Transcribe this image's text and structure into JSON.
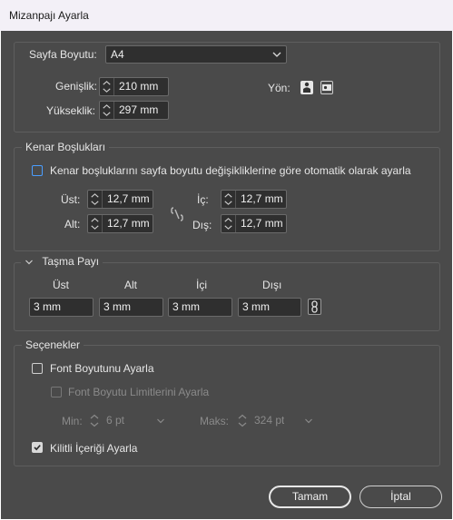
{
  "window": {
    "title": "Mizanpajı Ayarla"
  },
  "page_size": {
    "label": "Sayfa Boyutu:",
    "value": "A4",
    "width_label": "Genişlik:",
    "width_value": "210 mm",
    "height_label": "Yükseklik:",
    "height_value": "297 mm",
    "orientation_label": "Yön:"
  },
  "margins": {
    "title": "Kenar Boşlukları",
    "auto_adjust_label": "Kenar boşluklarını sayfa boyutu değişikliklerine göre otomatik olarak ayarla",
    "top_label": "Üst:",
    "top_value": "12,7 mm",
    "bottom_label": "Alt:",
    "bottom_value": "12,7 mm",
    "inside_label": "İç:",
    "inside_value": "12,7 mm",
    "outside_label": "Dış:",
    "outside_value": "12,7 mm"
  },
  "bleed": {
    "title": "Taşma Payı",
    "headers": [
      "Üst",
      "Alt",
      "İçi",
      "Dışı"
    ],
    "values": [
      "3 mm",
      "3 mm",
      "3 mm",
      "3 mm"
    ]
  },
  "options": {
    "title": "Seçenekler",
    "adjust_font_label": "Font Boyutunu Ayarla",
    "font_limits_label": "Font Boyutu Limitlerini Ayarla",
    "min_label": "Min:",
    "min_value": "6 pt",
    "max_label": "Maks:",
    "max_value": "324 pt",
    "adjust_locked_label": "Kilitli İçeriği Ayarla",
    "adjust_font_checked": false,
    "font_limits_checked": false,
    "adjust_locked_checked": true
  },
  "buttons": {
    "ok": "Tamam",
    "cancel": "İptal"
  }
}
